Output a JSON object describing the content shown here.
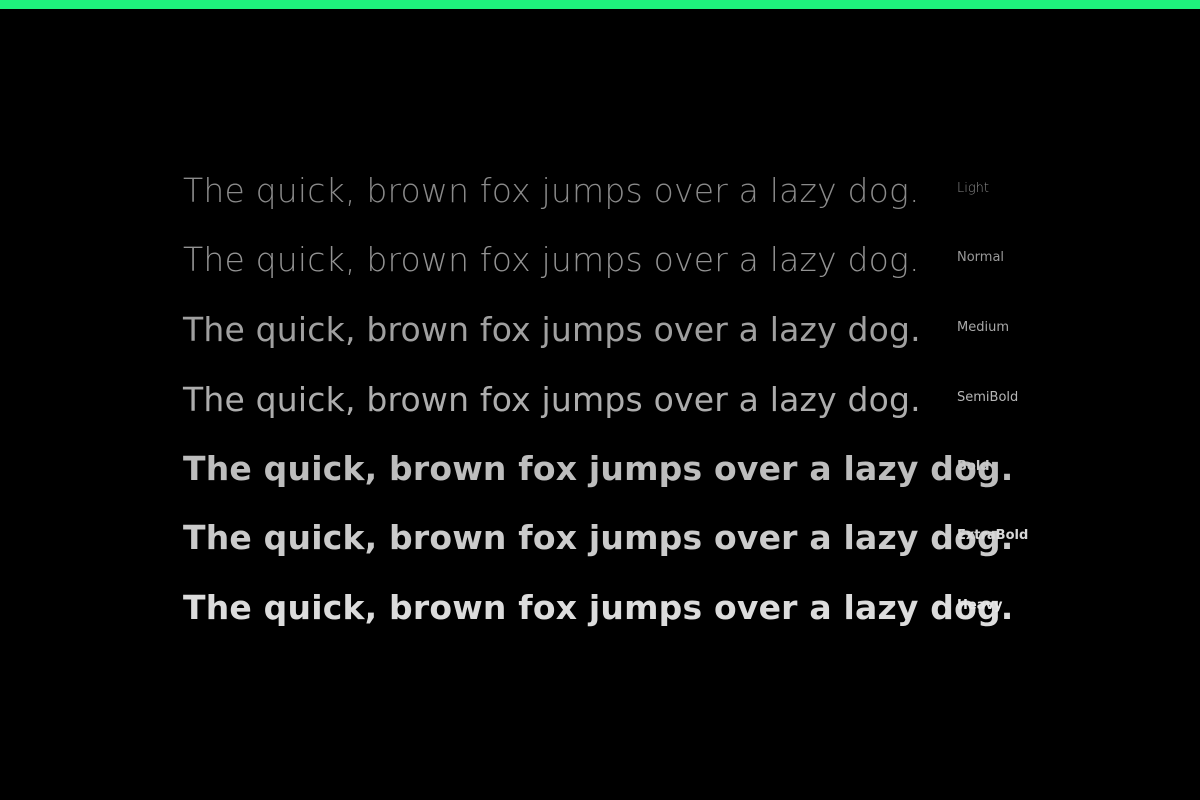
{
  "colors": {
    "background": "#000000",
    "accent": "#1ef27c"
  },
  "specimen": {
    "rows": [
      {
        "sample": "The quick, brown fox jumps over a lazy dog.",
        "weight": "Light"
      },
      {
        "sample": "The quick, brown fox jumps over a lazy dog.",
        "weight": "Normal"
      },
      {
        "sample": "The quick, brown fox jumps over a lazy dog.",
        "weight": "Medium"
      },
      {
        "sample": "The quick, brown fox jumps over a lazy dog.",
        "weight": "SemiBold"
      },
      {
        "sample": "The quick, brown fox jumps over a lazy dog.",
        "weight": "Bold"
      },
      {
        "sample": "The quick, brown fox jumps over a lazy dog.",
        "weight": "ExtraBold"
      },
      {
        "sample": "The quick, brown fox jumps over a lazy dog.",
        "weight": "Heavy"
      }
    ]
  }
}
